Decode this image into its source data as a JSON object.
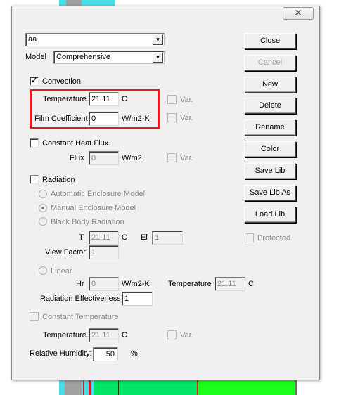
{
  "window": {
    "close_glyph": "✕",
    "close_icon": "close-icon"
  },
  "material": {
    "name": "aa",
    "model_label": "Model",
    "model_value": "Comprehensive"
  },
  "convection": {
    "label": "Convection",
    "checked": true,
    "temperature_label": "Temperature",
    "temperature_value": "21.11",
    "temperature_unit": "C",
    "film_label": "Film Coefficient",
    "film_value": "0",
    "film_unit": "W/m2-K",
    "var_label": "Var."
  },
  "heat_flux": {
    "label": "Constant Heat Flux",
    "flux_label": "Flux",
    "flux_value": "0",
    "flux_unit": "W/m2",
    "var_label": "Var."
  },
  "radiation": {
    "label": "Radiation",
    "options": [
      "Automatic Enclosure Model",
      "Manual Enclosure Model",
      "Black Body Radiation"
    ],
    "ti_label": "Ti",
    "ti_value": "21.11",
    "ti_unit": "C",
    "ei_label": "Ei",
    "ei_value": "1",
    "view_factor_label": "View Factor",
    "view_factor_value": "1",
    "linear_label": "Linear",
    "hr_label": "Hr",
    "hr_value": "0",
    "hr_unit": "W/m2-K",
    "temperature_label": "Temperature",
    "temperature_value": "21.11",
    "temperature_unit": "C",
    "effectiveness_label": "Radiation Effectiveness",
    "effectiveness_value": "1"
  },
  "constant_temperature": {
    "label": "Constant Temperature",
    "temperature_label": "Temperature",
    "temperature_value": "21.11",
    "temperature_unit": "C",
    "var_label": "Var."
  },
  "humidity": {
    "label": "Relative Humidity:",
    "value": "50",
    "unit": "%"
  },
  "buttons": {
    "close": "Close",
    "cancel": "Cancel",
    "new": "New",
    "delete": "Delete",
    "rename": "Rename",
    "color": "Color",
    "save_lib": "Save Lib",
    "save_lib_as": "Save Lib As",
    "load_lib": "Load Lib",
    "protected": "Protected"
  },
  "colors": {
    "highlight": "#e01b24",
    "dialog_bg": "#f0f0f0",
    "bg_green": "#00e664",
    "bg_cyan": "#48e0e8"
  }
}
